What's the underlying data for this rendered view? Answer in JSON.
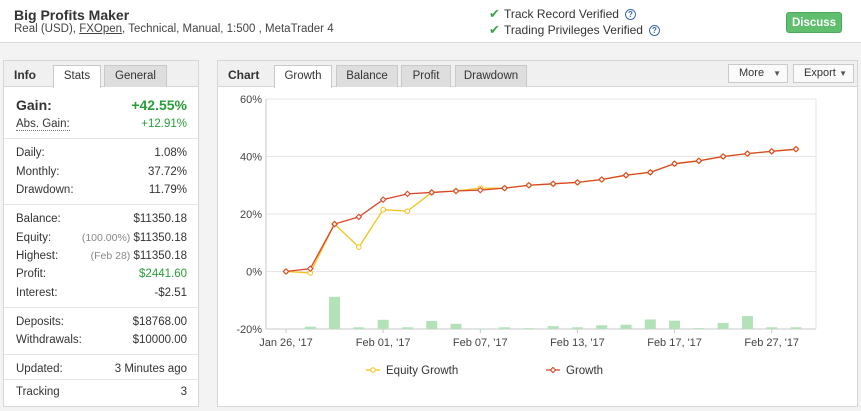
{
  "header": {
    "system_name": "Big Profits Maker",
    "account_type": "Real (USD), ",
    "broker": "FXOpen",
    "details": ", Technical, Manual, 1:500 , MetaTrader 4",
    "track_record": "Track Record Verified",
    "trading_privileges": "Trading Privileges Verified",
    "discuss": "Discuss"
  },
  "info": {
    "tabs": {
      "info": "Info",
      "stats": "Stats",
      "general": "General"
    },
    "gain": {
      "label": "Gain:",
      "value": "+42.55%"
    },
    "abs_gain": {
      "label": "Abs. Gain:",
      "value": "+12.91%"
    },
    "daily": {
      "label": "Daily:",
      "value": "1.08%"
    },
    "monthly": {
      "label": "Monthly:",
      "value": "37.72%"
    },
    "drawdown": {
      "label": "Drawdown:",
      "value": "11.79%"
    },
    "balance": {
      "label": "Balance:",
      "value": "$11350.18"
    },
    "equity": {
      "label": "Equity:",
      "note": "(100.00%)",
      "value": "$11350.18"
    },
    "highest": {
      "label": "Highest:",
      "note": "(Feb 28)",
      "value": "$11350.18"
    },
    "profit": {
      "label": "Profit:",
      "value": "$2441.60"
    },
    "interest": {
      "label": "Interest:",
      "value": "-$2.51"
    },
    "deposits": {
      "label": "Deposits:",
      "value": "$18768.00"
    },
    "withdrawals": {
      "label": "Withdrawals:",
      "value": "$10000.00"
    },
    "updated": {
      "label": "Updated:",
      "value": "3 Minutes ago"
    },
    "tracking": {
      "label": "Tracking",
      "value": "3"
    }
  },
  "chart_panel": {
    "title": "Chart",
    "tabs": {
      "growth": "Growth",
      "balance": "Balance",
      "profit": "Profit",
      "drawdown": "Drawdown"
    },
    "more": "More",
    "export": "Export"
  },
  "colors": {
    "equity": "#f2c319",
    "growth": "#d9472b",
    "bars": "#b3e2b8",
    "green": "#2a9d3a"
  },
  "chart_data": {
    "type": "line",
    "ylim": [
      -20,
      60
    ],
    "y_ticks": [
      "60%",
      "40%",
      "20%",
      "0%",
      "-20%"
    ],
    "x_ticks": [
      "Jan 26, '17",
      "Feb 01, '17",
      "Feb 07, '17",
      "Feb 13, '17",
      "Feb 17, '17",
      "Feb 27, '17"
    ],
    "series": [
      {
        "name": "Equity Growth",
        "values": [
          0,
          -0.5,
          16.5,
          8.5,
          21.5,
          21,
          27.5,
          28,
          29,
          29,
          30,
          30.5,
          31,
          32,
          33.5,
          34.5,
          37.5,
          38.5,
          40,
          41,
          41.8,
          42.55
        ]
      },
      {
        "name": "Growth",
        "values": [
          0,
          1,
          16.5,
          19,
          25,
          27,
          27.5,
          28,
          28.3,
          29,
          30,
          30.5,
          31,
          32,
          33.5,
          34.5,
          37.5,
          38.5,
          40,
          41,
          41.8,
          42.55
        ]
      }
    ],
    "bars": [
      0,
      0.8,
      11.2,
      0.6,
      3.2,
      0.6,
      2.8,
      1.8,
      0.2,
      0.6,
      0.3,
      1.0,
      0.6,
      1.3,
      1.5,
      3.3,
      2.9,
      0.3,
      2.1,
      4.5,
      0.6,
      0.6
    ],
    "grid": true,
    "legend": "bottom"
  }
}
